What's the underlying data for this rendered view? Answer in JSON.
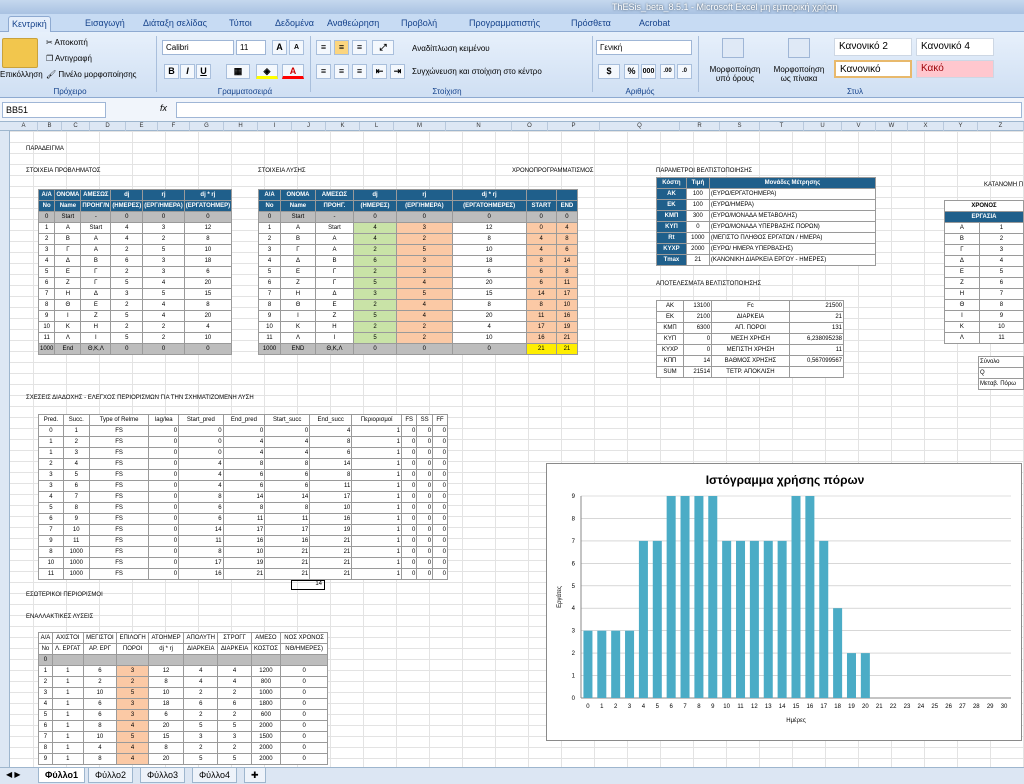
{
  "window": {
    "title": "ThESis_beta_8.5.1 - Microsoft Excel μη εμπορική χρήση"
  },
  "tabs": [
    "Κεντρική",
    "Εισαγωγή",
    "Διάταξη σελίδας",
    "Τύποι",
    "Δεδομένα",
    "Αναθεώρηση",
    "Προβολή",
    "Προγραμματιστής",
    "Πρόσθετα",
    "Acrobat"
  ],
  "ribbon": {
    "paste": "Επικόλληση",
    "cut": "Αποκοπή",
    "copy": "Αντιγραφή",
    "painter": "Πινέλο μορφοποίησης",
    "clipboard": "Πρόχειρο",
    "font_name": "Calibri",
    "font_size": "11",
    "font_group": "Γραμματοσειρά",
    "wrap": "Αναδίπλωση κειμένου",
    "merge": "Συγχώνευση και στοίχιση στο κέντρο",
    "align_group": "Στοίχιση",
    "number_format": "Γενική",
    "number_group": "Αριθμός",
    "cond_format": "Μορφοποίηση υπό όρους",
    "format_table": "Μορφοποίηση ως πίνακα",
    "style_normal2": "Κανονικό 2",
    "style_normal4": "Κανονικό 4",
    "style_normal": "Κανονικό",
    "style_bad": "Κακό",
    "styles_group": "Στυλ"
  },
  "formula": {
    "namebox": "BB51",
    "fx": "fx",
    "value": ""
  },
  "columns": [
    "A",
    "B",
    "C",
    "D",
    "E",
    "F",
    "G",
    "H",
    "I",
    "J",
    "K",
    "L",
    "M",
    "N",
    "O",
    "P",
    "Q",
    "R",
    "S",
    "T",
    "U",
    "V",
    "W",
    "X",
    "Y",
    "Z"
  ],
  "labels": {
    "example": "ΠΑΡΑΔΕΙΓΜΑ",
    "problem": "ΣΤΟΙΧΕΙΑ ΠΡΟΒΛΗΜΑΤΟΣ",
    "solution": "ΣΤΟΙΧΕΙΑ ΛΥΣΗΣ",
    "schedule": "ΧΡΟΝΟΠΡΟΓΡΑΜΜΑΤΙΣΜΟΣ",
    "params": "ΠΑΡΑΜΕΤΡΟΙ ΒΕΛΤΙΣΤΟΠΟΙΗΣΗΣ",
    "results": "ΑΠΟΤΕΛΕΣΜΑΤΑ ΒΕΛΤΙΣΤΟΠΟΙΗΣΗΣ",
    "distrib": "ΚΑΤΑΝΟΜΗ Π",
    "relations": "ΣΧΕΣΕΙΣ ΔΙΑΔΟΧΗΣ - ΕΛΕΓΧΟΣ ΠΕΡΙΟΡΙΣΜΩΝ ΓΙΑ ΤΗΝ ΣΧΗΜΑΤΙΖΟΜΕΝΗ ΛΥΣΗ",
    "internal": "ΕΣΩΤΕΡΙΚΟΙ ΠΕΡΙΟΡΙΣΜΟΙ",
    "alternatives": "ΕΝΑΛΛΑΚΤΙΚΕΣ ΛΥΣΕΙΣ",
    "relations_sum": "14"
  },
  "problem_table": {
    "headers": [
      [
        "Α/Α",
        "No"
      ],
      [
        "ΟΝΟΜΑ",
        "Name"
      ],
      [
        "ΑΜΕΣΩΣ",
        "ΠΡΟΗΓ/Ν"
      ],
      [
        "dj",
        "(ΗΜΕΡΕΣ)"
      ],
      [
        "rj",
        "(ΕΡΓ/ΗΜΕΡΑ)"
      ],
      [
        "dj * rj",
        "(ΕΡΓΑΤΟΗΜΕΡ)"
      ]
    ],
    "rows": [
      [
        "0",
        "Start",
        "-",
        "0",
        "0",
        "0"
      ],
      [
        "1",
        "Α",
        "Start",
        "4",
        "3",
        "12"
      ],
      [
        "2",
        "Β",
        "Α",
        "4",
        "2",
        "8"
      ],
      [
        "3",
        "Γ",
        "Α",
        "2",
        "5",
        "10"
      ],
      [
        "4",
        "Δ",
        "Β",
        "6",
        "3",
        "18"
      ],
      [
        "5",
        "Ε",
        "Γ",
        "2",
        "3",
        "6"
      ],
      [
        "6",
        "Ζ",
        "Γ",
        "5",
        "4",
        "20"
      ],
      [
        "7",
        "Η",
        "Δ",
        "3",
        "5",
        "15"
      ],
      [
        "8",
        "Θ",
        "Ε",
        "2",
        "4",
        "8"
      ],
      [
        "9",
        "Ι",
        "Ζ",
        "5",
        "4",
        "20"
      ],
      [
        "10",
        "Κ",
        "Η",
        "2",
        "2",
        "4"
      ],
      [
        "11",
        "Λ",
        "Ι",
        "5",
        "2",
        "10"
      ],
      [
        "1000",
        "End",
        "Θ,Κ,Λ",
        "0",
        "0",
        "0"
      ]
    ]
  },
  "solution_table": {
    "headers": [
      [
        "Α/Α",
        "No"
      ],
      [
        "ΟΝΟΜΑ",
        "Name"
      ],
      [
        "ΑΜΕΣΩΣ",
        "ΠΡΟΗΓ."
      ],
      [
        "dj",
        "(ΗΜΕΡΕΣ)"
      ],
      [
        "rj",
        "(ΕΡΓ/ΗΜΕΡΑ)"
      ],
      [
        "dj * rj",
        "(ΕΡΓΑΤΟΗΜΕΡΕΣ)"
      ],
      [
        "",
        "START"
      ],
      [
        "",
        "END"
      ]
    ],
    "rows": [
      [
        "0",
        "Start",
        "-",
        "0",
        "0",
        "0",
        "0",
        "0"
      ],
      [
        "1",
        "Α",
        "Start",
        "4",
        "3",
        "12",
        "0",
        "4"
      ],
      [
        "2",
        "Β",
        "Α",
        "4",
        "2",
        "8",
        "4",
        "8"
      ],
      [
        "3",
        "Γ",
        "Α",
        "2",
        "5",
        "10",
        "4",
        "6"
      ],
      [
        "4",
        "Δ",
        "Β",
        "6",
        "3",
        "18",
        "8",
        "14"
      ],
      [
        "5",
        "Ε",
        "Γ",
        "2",
        "3",
        "6",
        "6",
        "8"
      ],
      [
        "6",
        "Ζ",
        "Γ",
        "5",
        "4",
        "20",
        "6",
        "11"
      ],
      [
        "7",
        "Η",
        "Δ",
        "3",
        "5",
        "15",
        "14",
        "17"
      ],
      [
        "8",
        "Θ",
        "Ε",
        "2",
        "4",
        "8",
        "8",
        "10"
      ],
      [
        "9",
        "Ι",
        "Ζ",
        "5",
        "4",
        "20",
        "11",
        "16"
      ],
      [
        "10",
        "Κ",
        "Η",
        "2",
        "2",
        "4",
        "17",
        "19"
      ],
      [
        "11",
        "Λ",
        "Ι",
        "5",
        "2",
        "10",
        "16",
        "21"
      ],
      [
        "1000",
        "END",
        "Θ,Κ,Λ",
        "0",
        "0",
        "0",
        "21",
        "21"
      ]
    ]
  },
  "params_table": {
    "headers": [
      "Κόστη",
      "Τιμή",
      "Μονάδες Μέτρησης"
    ],
    "rows": [
      [
        "ΑΚ",
        "100",
        "(ΕΥΡΩ/ΕΡΓΑΤΟΗΜΕΡΑ)"
      ],
      [
        "ΕΚ",
        "100",
        "(ΕΥΡΩ/ΗΜΕΡΑ)"
      ],
      [
        "ΚΜΠ",
        "300",
        "(ΕΥΡΩ/ΜΟΝΑΔΑ ΜΕΤΑΒΟΛΗΣ)"
      ],
      [
        "ΚΥΠ",
        "0",
        "(ΕΥΡΩ/ΜΟΝΑΔΑ ΥΠΕΡΒΑΣΗΣ ΠΟΡΩΝ)"
      ],
      [
        "Rt",
        "1000",
        "(ΜΕΓΙΣΤΟ ΠΛΗΘΟΣ ΕΡΓΑΤΩΝ / ΗΜΕΡΑ)"
      ],
      [
        "ΚΥΧΡ",
        "2000",
        "(ΕΥΡΩ/ ΗΜΕΡΑ ΥΠΕΡΒΑΣΗΣ)"
      ],
      [
        "Tmax",
        "21",
        "(ΚΑΝΟΝΙΚΗ ΔΙΑΡΚΕΙΑ ΕΡΓΟΥ - ΗΜΕΡΕΣ)"
      ]
    ]
  },
  "results_table": {
    "rows": [
      [
        "ΑΚ",
        "13100",
        "Fc",
        "21500"
      ],
      [
        "ΕΚ",
        "2100",
        "ΔΙΑΡΚΕΙΑ",
        "21"
      ],
      [
        "ΚΜΠ",
        "6300",
        "ΑΠ. ΠΟΡΟΙ",
        "131"
      ],
      [
        "ΚΥΠ",
        "0",
        "ΜΕΣΗ ΧΡΗΣΗ",
        "6,238095238"
      ],
      [
        "ΚΥΧΡ",
        "0",
        "ΜΕΓΙΣΤΗ ΧΡΗΣΗ",
        "11"
      ],
      [
        "ΚΠΠ",
        "14",
        "ΒΑΘΜΟΣ ΧΡΗΣΗΣ",
        "0,567099567"
      ],
      [
        "SUM",
        "21514",
        "ΤΕΤΡ. ΑΠΟΚΛΙΣΗ",
        ""
      ]
    ]
  },
  "distrib_table": {
    "header1": "ΧΡΟΝΟΣ",
    "header2": "ΕΡΓΑΣΙΑ",
    "rows": [
      [
        "Α",
        "1"
      ],
      [
        "Β",
        "2"
      ],
      [
        "Γ",
        "3"
      ],
      [
        "Δ",
        "4"
      ],
      [
        "Ε",
        "5"
      ],
      [
        "Ζ",
        "6"
      ],
      [
        "Η",
        "7"
      ],
      [
        "Θ",
        "8"
      ],
      [
        "Ι",
        "9"
      ],
      [
        "Κ",
        "10"
      ],
      [
        "Λ",
        "11"
      ]
    ],
    "footer": [
      "Σύνολο",
      "Q",
      "Μεταβ. Πόρω"
    ]
  },
  "relations_table": {
    "headers": [
      "Pred.",
      "Succ.",
      "Type of Relme",
      "lag/lea",
      "Start_pred",
      "End_pred",
      "Start_succ",
      "End_succ",
      "Περιορισμοί",
      "FS",
      "SS",
      "FF"
    ],
    "rows": [
      [
        "0",
        "1",
        "FS",
        "0",
        "0",
        "0",
        "0",
        "4",
        "1",
        "0",
        "0",
        "0"
      ],
      [
        "1",
        "2",
        "FS",
        "0",
        "0",
        "4",
        "4",
        "8",
        "1",
        "0",
        "0",
        "0"
      ],
      [
        "1",
        "3",
        "FS",
        "0",
        "0",
        "4",
        "4",
        "6",
        "1",
        "0",
        "0",
        "0"
      ],
      [
        "2",
        "4",
        "FS",
        "0",
        "4",
        "8",
        "8",
        "14",
        "1",
        "0",
        "0",
        "0"
      ],
      [
        "3",
        "5",
        "FS",
        "0",
        "4",
        "6",
        "6",
        "8",
        "1",
        "0",
        "0",
        "0"
      ],
      [
        "3",
        "6",
        "FS",
        "0",
        "4",
        "6",
        "6",
        "11",
        "1",
        "0",
        "0",
        "0"
      ],
      [
        "4",
        "7",
        "FS",
        "0",
        "8",
        "14",
        "14",
        "17",
        "1",
        "0",
        "0",
        "0"
      ],
      [
        "5",
        "8",
        "FS",
        "0",
        "6",
        "8",
        "8",
        "10",
        "1",
        "0",
        "0",
        "0"
      ],
      [
        "6",
        "9",
        "FS",
        "0",
        "6",
        "11",
        "11",
        "16",
        "1",
        "0",
        "0",
        "0"
      ],
      [
        "7",
        "10",
        "FS",
        "0",
        "14",
        "17",
        "17",
        "19",
        "1",
        "0",
        "0",
        "0"
      ],
      [
        "9",
        "11",
        "FS",
        "0",
        "11",
        "16",
        "16",
        "21",
        "1",
        "0",
        "0",
        "0"
      ],
      [
        "8",
        "1000",
        "FS",
        "0",
        "8",
        "10",
        "21",
        "21",
        "1",
        "0",
        "0",
        "0"
      ],
      [
        "10",
        "1000",
        "FS",
        "0",
        "17",
        "19",
        "21",
        "21",
        "1",
        "0",
        "0",
        "0"
      ],
      [
        "11",
        "1000",
        "FS",
        "0",
        "16",
        "21",
        "21",
        "21",
        "1",
        "0",
        "0",
        "0"
      ]
    ]
  },
  "alt_table": {
    "headers": [
      [
        "Α/Α",
        "No"
      ],
      [
        "ΑΧΙΣΤΟΙ",
        "Λ. ΕΡΓΑΤ"
      ],
      [
        "ΜΕΓΙΣΤΟΙ",
        "ΑΡ. ΕΡΓ"
      ],
      [
        "ΕΠΙΛΟΓΗ",
        "ΠΟΡΟΙ"
      ],
      [
        "ΑΤΟΗΜΕΡ",
        "dj * rj"
      ],
      [
        "ΑΠΟΛΥΤΗ",
        "ΔΙΑΡΚΕΙΑ"
      ],
      [
        "ΣΤΡΟΓΓ",
        "ΔΙΑΡΚΕΙΑ"
      ],
      [
        "ΑΜΕΣΟ",
        "ΚΟΣΤΟΣ"
      ],
      [
        "ΝΟΣ ΧΡΟΝΟΣ",
        "ΝΘ/ΗΜΕΡΕΣ)"
      ]
    ],
    "rows": [
      [
        "0",
        "",
        "",
        "",
        "",
        "",
        "",
        "",
        ""
      ],
      [
        "1",
        "1",
        "6",
        "3",
        "12",
        "4",
        "4",
        "1200",
        "0"
      ],
      [
        "2",
        "1",
        "2",
        "2",
        "8",
        "4",
        "4",
        "800",
        "0"
      ],
      [
        "3",
        "1",
        "10",
        "5",
        "10",
        "2",
        "2",
        "1000",
        "0"
      ],
      [
        "4",
        "1",
        "6",
        "3",
        "18",
        "6",
        "6",
        "1800",
        "0"
      ],
      [
        "5",
        "1",
        "6",
        "3",
        "6",
        "2",
        "2",
        "600",
        "0"
      ],
      [
        "6",
        "1",
        "8",
        "4",
        "20",
        "5",
        "5",
        "2000",
        "0"
      ],
      [
        "7",
        "1",
        "10",
        "5",
        "15",
        "3",
        "3",
        "1500",
        "0"
      ],
      [
        "8",
        "1",
        "4",
        "4",
        "8",
        "2",
        "2",
        "2000",
        "0"
      ],
      [
        "9",
        "1",
        "8",
        "4",
        "20",
        "5",
        "5",
        "2000",
        "0"
      ]
    ]
  },
  "chart_data": {
    "type": "bar",
    "title": "Ιστόγραμμα χρήσης πόρων",
    "xlabel": "Ημέρες",
    "ylabel": "Εργάτες",
    "categories": [
      "0",
      "1",
      "2",
      "3",
      "4",
      "5",
      "6",
      "7",
      "8",
      "9",
      "10",
      "11",
      "12",
      "13",
      "14",
      "15",
      "16",
      "17",
      "18",
      "19",
      "20",
      "21",
      "22",
      "23",
      "24",
      "25",
      "26",
      "27",
      "28",
      "29",
      "30"
    ],
    "values": [
      3,
      3,
      3,
      3,
      7,
      7,
      9,
      9,
      9,
      9,
      7,
      7,
      7,
      7,
      7,
      9,
      9,
      7,
      4,
      2,
      2,
      0,
      0,
      0,
      0,
      0,
      0,
      0,
      0,
      0,
      0
    ],
    "ylim": [
      0,
      9
    ],
    "yticks": [
      0,
      1,
      2,
      3,
      4,
      5,
      6,
      7,
      8,
      9
    ],
    "grid": true,
    "bar_color": "#4bacc6"
  },
  "sheets": [
    "Φύλλο1",
    "Φύλλο2",
    "Φύλλο3",
    "Φύλλο4"
  ]
}
